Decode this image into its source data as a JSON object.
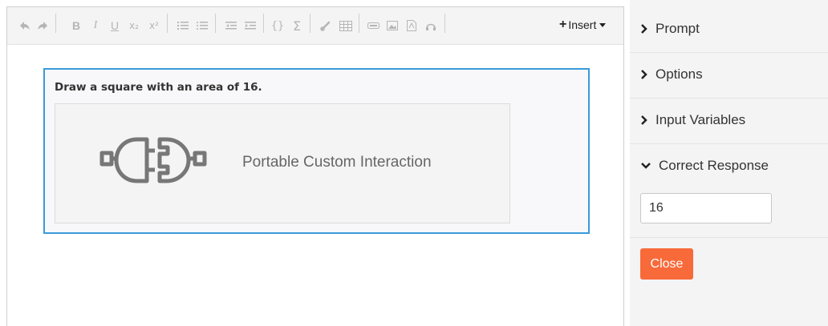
{
  "toolbar": {
    "icons": [
      "undo-icon",
      "redo-icon",
      "bold-icon",
      "italic-icon",
      "underline-icon",
      "subscript-icon",
      "superscript-icon",
      "ordered-list-icon",
      "unordered-list-icon",
      "outdent-icon",
      "indent-icon",
      "code-braces-icon",
      "sum-icon",
      "link-icon",
      "table-icon",
      "media-icon",
      "image-icon",
      "pdf-icon",
      "audio-icon"
    ],
    "bold": "B",
    "italic": "I",
    "underline": "U",
    "subscript": "x₂",
    "superscript": "x²",
    "braces": "{}",
    "sum": "Σ",
    "insert_label": "Insert"
  },
  "editor": {
    "question": "Draw a square with an area of 16.",
    "interaction_label": "Portable Custom Interaction"
  },
  "panel": {
    "sections": [
      {
        "label": "Prompt",
        "expanded": false
      },
      {
        "label": "Options",
        "expanded": false
      },
      {
        "label": "Input Variables",
        "expanded": false
      },
      {
        "label": "Correct Response",
        "expanded": true
      }
    ],
    "correct_response_value": "16",
    "close_label": "Close"
  },
  "colors": {
    "accent_border": "#3a9ad9",
    "close_button": "#f86a3a"
  }
}
